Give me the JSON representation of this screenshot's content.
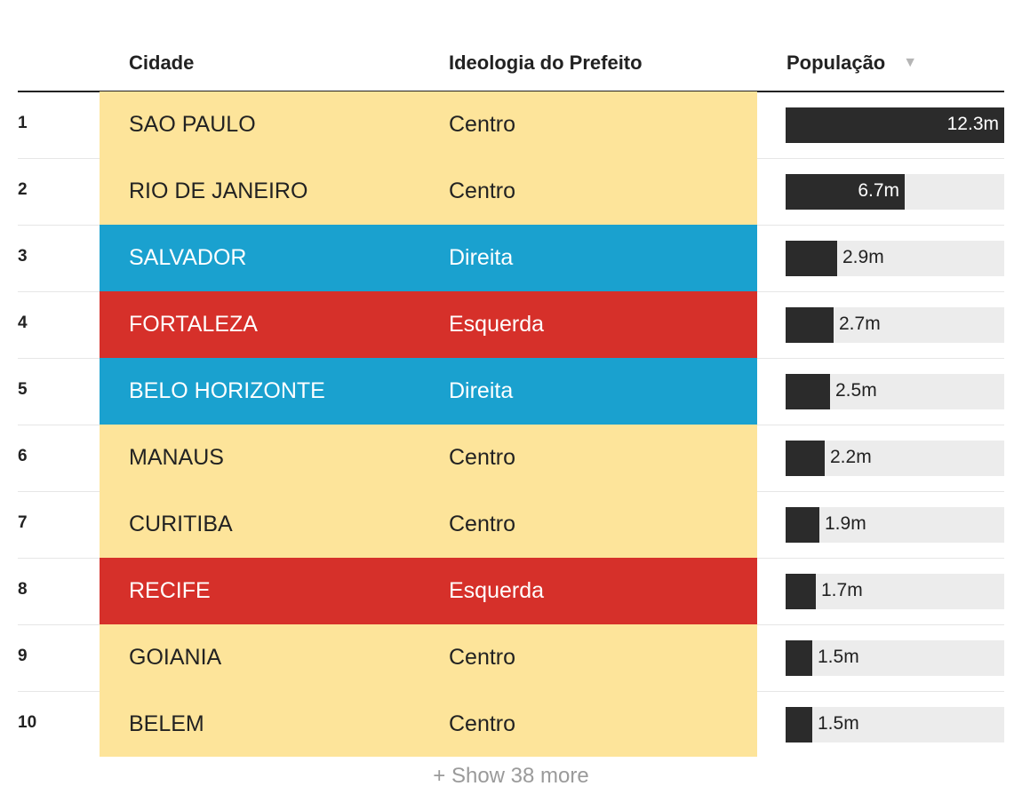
{
  "header": {
    "col_city": "Cidade",
    "col_ideology": "Ideologia do Prefeito",
    "col_population": "População",
    "sort_icon": "▼"
  },
  "colors": {
    "Centro": "#fde49a",
    "Direita": "#1aa1cf",
    "Esquerda": "#d6302a",
    "bar": "#2b2b2b",
    "track": "#ececec"
  },
  "footer": {
    "show_more": "+ Show 38 more"
  },
  "chart_data": {
    "type": "table",
    "columns": [
      "Cidade",
      "Ideologia do Prefeito",
      "População"
    ],
    "rows": [
      {
        "rank": "1",
        "city": "SAO PAULO",
        "ideology": "Centro",
        "population": 12.3,
        "population_label": "12.3m"
      },
      {
        "rank": "2",
        "city": "RIO DE JANEIRO",
        "ideology": "Centro",
        "population": 6.7,
        "population_label": "6.7m"
      },
      {
        "rank": "3",
        "city": "SALVADOR",
        "ideology": "Direita",
        "population": 2.9,
        "population_label": "2.9m"
      },
      {
        "rank": "4",
        "city": "FORTALEZA",
        "ideology": "Esquerda",
        "population": 2.7,
        "population_label": "2.7m"
      },
      {
        "rank": "5",
        "city": "BELO HORIZONTE",
        "ideology": "Direita",
        "population": 2.5,
        "population_label": "2.5m"
      },
      {
        "rank": "6",
        "city": "MANAUS",
        "ideology": "Centro",
        "population": 2.2,
        "population_label": "2.2m"
      },
      {
        "rank": "7",
        "city": "CURITIBA",
        "ideology": "Centro",
        "population": 1.9,
        "population_label": "1.9m"
      },
      {
        "rank": "8",
        "city": "RECIFE",
        "ideology": "Esquerda",
        "population": 1.7,
        "population_label": "1.7m"
      },
      {
        "rank": "9",
        "city": "GOIANIA",
        "ideology": "Centro",
        "population": 1.5,
        "population_label": "1.5m"
      },
      {
        "rank": "10",
        "city": "BELEM",
        "ideology": "Centro",
        "population": 1.5,
        "population_label": "1.5m"
      }
    ],
    "population_max": 12.3
  }
}
